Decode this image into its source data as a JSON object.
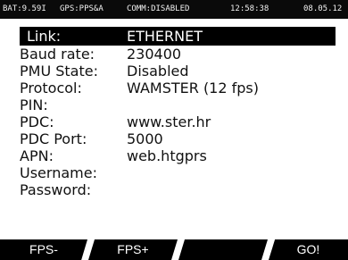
{
  "status_bar": {
    "battery": "BAT:9.59I",
    "gps": "GPS:PPS&A",
    "comm": "COMM:DISABLED",
    "time": "12:58:38",
    "date": "08.05.12"
  },
  "fields": [
    {
      "label": "Link:",
      "value": "ETHERNET",
      "selected": true
    },
    {
      "label": "Baud rate:",
      "value": "230400"
    },
    {
      "label": "PMU State:",
      "value": "Disabled"
    },
    {
      "label": "Protocol:",
      "value": "WAMSTER (12 fps)"
    },
    {
      "label": "PIN:",
      "value": ""
    },
    {
      "label": "PDC:",
      "value": "www.ster.hr"
    },
    {
      "label": "PDC Port:",
      "value": "5000"
    },
    {
      "label": "APN:",
      "value": "web.htgprs"
    },
    {
      "label": "Username:",
      "value": ""
    },
    {
      "label": "Password:",
      "value": ""
    }
  ],
  "softkeys": [
    "FPS-",
    "FPS+",
    "",
    "GO!"
  ],
  "colors": {
    "bar": "#000000",
    "background": "#ffffff",
    "text": "#111111"
  }
}
